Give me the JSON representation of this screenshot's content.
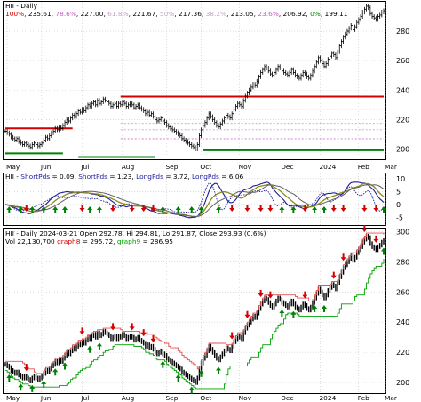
{
  "colors": {
    "background": "#ffffff",
    "frame": "#000000",
    "grid": "#c8c8c8",
    "candle": "#000000",
    "resistance": "#d40000",
    "support": "#008000",
    "fib_lines": "#c8a0c8",
    "short_pds": "#1c1c9c",
    "long_pds": "#8a8a1a",
    "arrow_up": "#008000",
    "arrow_down": "#d40000",
    "graph8": "#e05050",
    "graph9": "#00a000"
  },
  "x_axis": {
    "months": [
      "May",
      "Jun",
      "Jul",
      "Aug",
      "Sep",
      "Oct",
      "Nov",
      "Dec",
      "2024",
      "Feb",
      "Mar"
    ]
  },
  "panel1": {
    "legend_line1": "HII - Daily",
    "fib_legend": [
      {
        "text": "100%",
        "color": "#d40000"
      },
      {
        "text": ", 235.61, ",
        "color": "#000000"
      },
      {
        "text": "78.6%",
        "color": "#c85ac8"
      },
      {
        "text": ", 227.00, ",
        "color": "#000000"
      },
      {
        "text": "61.8%",
        "color": "#c8a0c8"
      },
      {
        "text": ", 221.67, ",
        "color": "#000000"
      },
      {
        "text": "50%",
        "color": "#c8a0c8"
      },
      {
        "text": ", 217.36, ",
        "color": "#000000"
      },
      {
        "text": "38.2%",
        "color": "#c8a0c8"
      },
      {
        "text": ", 213.05, ",
        "color": "#000000"
      },
      {
        "text": "23.6%",
        "color": "#c85ac8"
      },
      {
        "text": ", 206.92, ",
        "color": "#000000"
      },
      {
        "text": "0%",
        "color": "#008000"
      },
      {
        "text": ", 199.11",
        "color": "#000000"
      }
    ],
    "y_ticks": [
      "200",
      "220",
      "240",
      "260",
      "280"
    ]
  },
  "panel2": {
    "legend": [
      {
        "text": "HII - ",
        "color": "#000000"
      },
      {
        "text": "ShortPds",
        "color": "#1c1c9c"
      },
      {
        "text": " = 0.09, ",
        "color": "#000000"
      },
      {
        "text": "ShortPds",
        "color": "#1c1c9c"
      },
      {
        "text": " = 1.23, ",
        "color": "#000000"
      },
      {
        "text": "LongPds",
        "color": "#1c1c9c"
      },
      {
        "text": " = 3.72, ",
        "color": "#000000"
      },
      {
        "text": "LongPds",
        "color": "#1c1c9c"
      },
      {
        "text": " = 6.06",
        "color": "#000000"
      }
    ],
    "y_ticks": [
      "10",
      "5",
      "0",
      "-5"
    ]
  },
  "panel3": {
    "legend_line1": "HII - Daily 2024-03-21 Open 292.78, Hi 294.81, Lo 291.87, Close 293.93 (0.6%)",
    "legend_line2": [
      {
        "text": "Vol 22,130,700 ",
        "color": "#000000"
      },
      {
        "text": "graph8",
        "color": "#d40000"
      },
      {
        "text": " = 295.72, ",
        "color": "#000000"
      },
      {
        "text": "graph9",
        "color": "#00a000"
      },
      {
        "text": " = 286.95",
        "color": "#000000"
      }
    ],
    "y_ticks": [
      "300",
      "280",
      "260",
      "240",
      "220",
      "200"
    ]
  },
  "chart_data": {
    "type": "candlestick",
    "ticker": "HII",
    "interval": "Daily",
    "last_bar": {
      "date": "2024-03-21",
      "open": 292.78,
      "high": 294.81,
      "low": 291.87,
      "close": 293.93,
      "change_pct": 0.6,
      "volume": 22130700
    },
    "price_axis": {
      "ylim": [
        193,
        300
      ],
      "ticks": [
        200,
        220,
        240,
        260,
        280
      ]
    },
    "closes": [
      212,
      211,
      210,
      208,
      207,
      206,
      207,
      205,
      204,
      203,
      204,
      203,
      202,
      201,
      203,
      204,
      203,
      202,
      203,
      204,
      206,
      208,
      207,
      209,
      211,
      212,
      214,
      213,
      215,
      214,
      216,
      218,
      220,
      219,
      221,
      223,
      222,
      224,
      226,
      225,
      227,
      226,
      228,
      230,
      229,
      231,
      232,
      230,
      233,
      231,
      232,
      234,
      233,
      232,
      231,
      229,
      230,
      231,
      229,
      231,
      230,
      232,
      231,
      229,
      230,
      231,
      230,
      228,
      229,
      230,
      228,
      227,
      226,
      224,
      225,
      223,
      224,
      222,
      220,
      219,
      220,
      221,
      219,
      218,
      216,
      215,
      214,
      213,
      212,
      211,
      210,
      209,
      207,
      206,
      205,
      204,
      203,
      202,
      201,
      200,
      203,
      209,
      213,
      216,
      218,
      221,
      224,
      222,
      220,
      218,
      216,
      215,
      217,
      219,
      221,
      223,
      222,
      221,
      224,
      227,
      229,
      231,
      230,
      229,
      233,
      236,
      238,
      240,
      242,
      244,
      243,
      246,
      249,
      252,
      254,
      256,
      255,
      253,
      251,
      250,
      252,
      254,
      256,
      255,
      253,
      252,
      251,
      250,
      252,
      254,
      252,
      250,
      249,
      248,
      250,
      252,
      251,
      249,
      248,
      250,
      253,
      256,
      259,
      262,
      260,
      258,
      256,
      258,
      261,
      263,
      265,
      264,
      262,
      266,
      270,
      273,
      276,
      278,
      280,
      282,
      284,
      281,
      283,
      286,
      288,
      290,
      293,
      295,
      297,
      296,
      292,
      290,
      289,
      288,
      290,
      291,
      293,
      294
    ],
    "fibonacci": [
      {
        "level": "100%",
        "value": 235.61
      },
      {
        "level": "78.6%",
        "value": 227.0
      },
      {
        "level": "61.8%",
        "value": 221.67
      },
      {
        "level": "50%",
        "value": 217.36
      },
      {
        "level": "38.2%",
        "value": 213.05
      },
      {
        "level": "23.6%",
        "value": 206.92
      },
      {
        "level": "0%",
        "value": 199.11
      }
    ],
    "oscillator": {
      "ylim": [
        -8,
        12
      ],
      "ticks": [
        10,
        5,
        0,
        -5
      ],
      "series": [
        {
          "name": "ShortPds",
          "last": 0.09
        },
        {
          "name": "ShortPds",
          "last": 1.23
        },
        {
          "name": "LongPds",
          "last": 3.72
        },
        {
          "name": "LongPds",
          "last": 6.06
        }
      ]
    },
    "lower_panel": {
      "ylim": [
        193,
        302
      ],
      "ticks": [
        300,
        280,
        260,
        240,
        220,
        200
      ],
      "series": [
        {
          "name": "graph8",
          "last": 295.72
        },
        {
          "name": "graph9",
          "last": 286.95
        }
      ]
    }
  }
}
